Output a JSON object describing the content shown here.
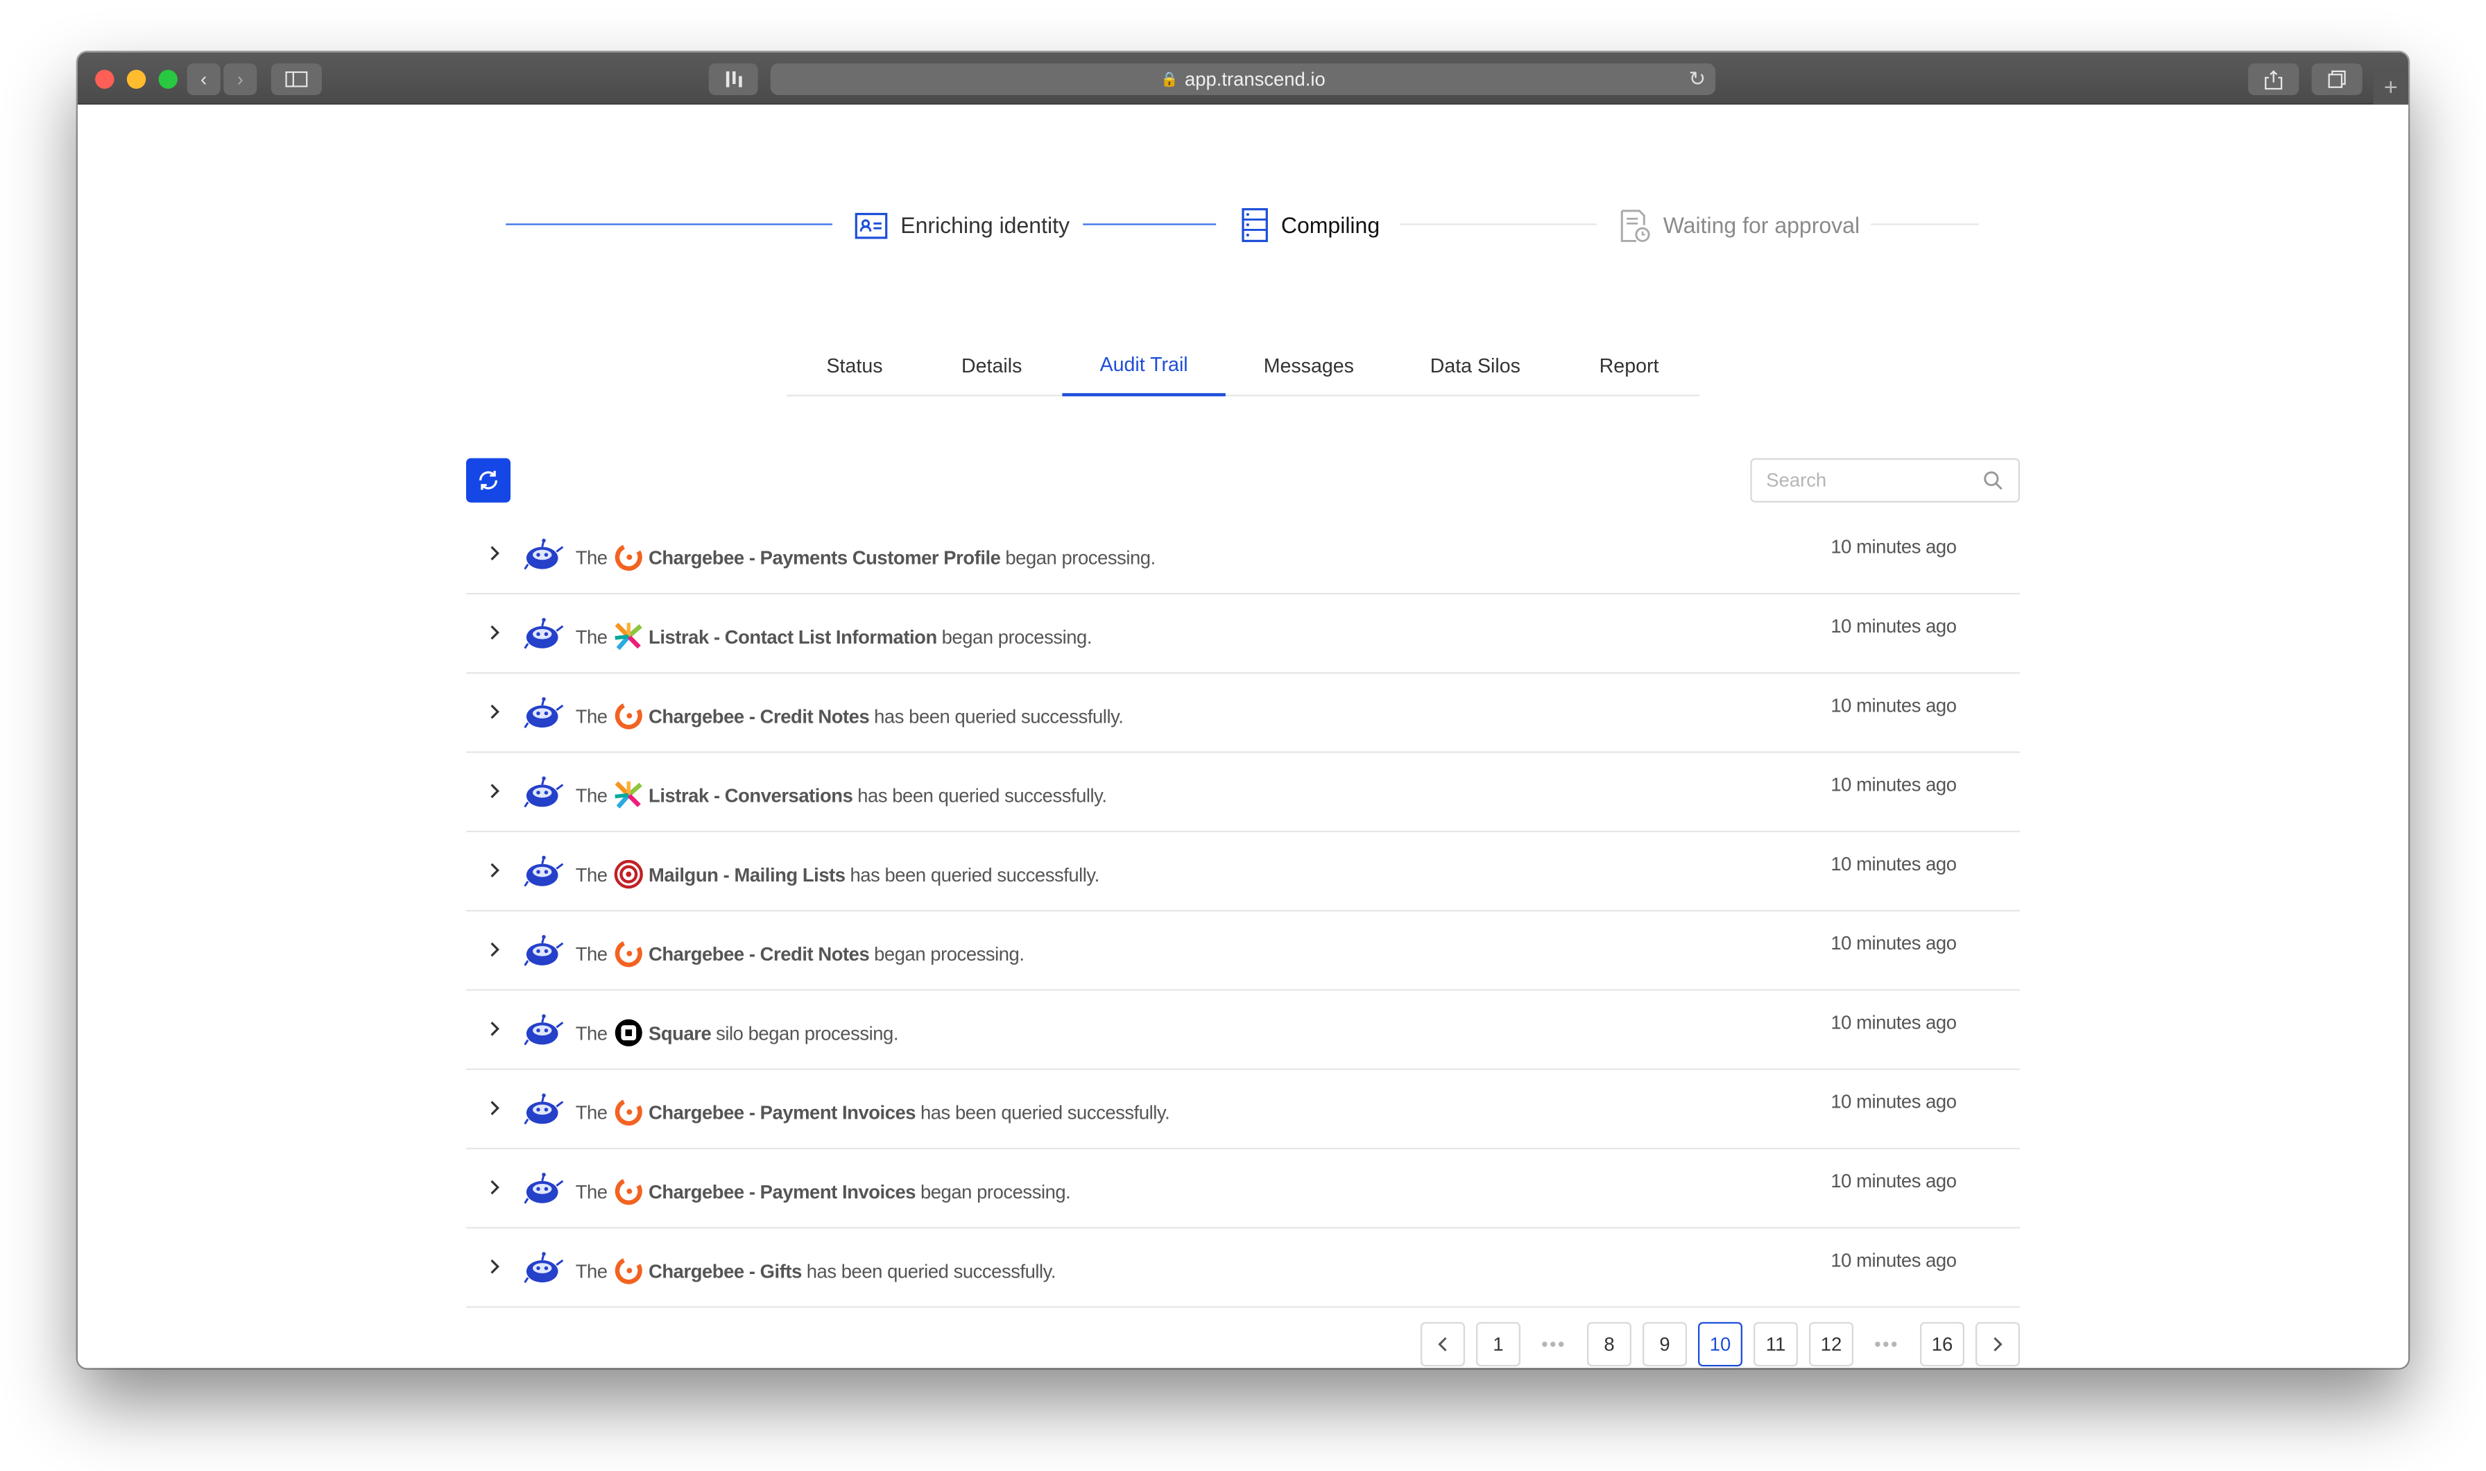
{
  "browser": {
    "url": "app.transcend.io"
  },
  "stepper": {
    "steps": [
      {
        "label": "Enriching identity",
        "state": "done"
      },
      {
        "label": "Compiling",
        "state": "current"
      },
      {
        "label": "Waiting for approval",
        "state": "pending"
      }
    ]
  },
  "tabs": [
    {
      "label": "Status"
    },
    {
      "label": "Details"
    },
    {
      "label": "Audit Trail",
      "active": true
    },
    {
      "label": "Messages"
    },
    {
      "label": "Data Silos"
    },
    {
      "label": "Report"
    }
  ],
  "search": {
    "placeholder": "Search"
  },
  "rows": [
    {
      "prefix": "The",
      "silo": "Chargebee - Payments Customer Profile",
      "logo": "chargebee-logo",
      "message": "began processing.",
      "time": "10 minutes ago"
    },
    {
      "prefix": "The",
      "silo": "Listrak - Contact List Information",
      "logo": "listrak-logo",
      "message": "began processing.",
      "time": "10 minutes ago"
    },
    {
      "prefix": "The",
      "silo": "Chargebee - Credit Notes",
      "logo": "chargebee-logo",
      "message": "has been queried successfully.",
      "time": "10 minutes ago"
    },
    {
      "prefix": "The",
      "silo": "Listrak - Conversations",
      "logo": "listrak-logo",
      "message": "has been queried successfully.",
      "time": "10 minutes ago"
    },
    {
      "prefix": "The",
      "silo": "Mailgun - Mailing Lists",
      "logo": "mailgun-logo",
      "message": "has been queried successfully.",
      "time": "10 minutes ago"
    },
    {
      "prefix": "The",
      "silo": "Chargebee - Credit Notes",
      "logo": "chargebee-logo",
      "message": "began processing.",
      "time": "10 minutes ago"
    },
    {
      "prefix": "The",
      "silo": "Square",
      "logo": "square-logo",
      "message": "silo began processing.",
      "time": "10 minutes ago"
    },
    {
      "prefix": "The",
      "silo": "Chargebee - Payment Invoices",
      "logo": "chargebee-logo",
      "message": "has been queried successfully.",
      "time": "10 minutes ago"
    },
    {
      "prefix": "The",
      "silo": "Chargebee - Payment Invoices",
      "logo": "chargebee-logo",
      "message": "began processing.",
      "time": "10 minutes ago"
    },
    {
      "prefix": "The",
      "silo": "Chargebee - Gifts",
      "logo": "chargebee-logo",
      "message": "has been queried successfully.",
      "time": "10 minutes ago"
    }
  ],
  "pagination": {
    "pages": [
      "1",
      "•••",
      "8",
      "9",
      "10",
      "11",
      "12",
      "•••",
      "16"
    ],
    "current": "10"
  },
  "colors": {
    "accent": "#1d4ed8",
    "chargebee": "#f26322",
    "mailgun": "#c02126"
  }
}
